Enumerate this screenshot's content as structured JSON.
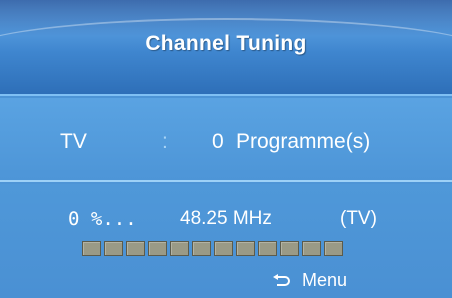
{
  "header": {
    "title": "Channel Tuning"
  },
  "info": {
    "source": "TV",
    "separator": ":",
    "programme_count": "0",
    "programme_label": "Programme(s)"
  },
  "scan": {
    "percent_text": "0 %...",
    "frequency_text": "48.25 MHz",
    "mode_text": "(TV)",
    "progress": {
      "total_cells": 12,
      "filled_cells": 0,
      "percent": 0
    }
  },
  "footer": {
    "return_icon": "return-arrow-icon",
    "menu_label": "Menu"
  },
  "colors": {
    "background": "#4a90d2",
    "header": "#3f86cf",
    "text": "#ffffff",
    "progress_empty": "#9a9a86",
    "progress_filled": "#e0d24a"
  }
}
